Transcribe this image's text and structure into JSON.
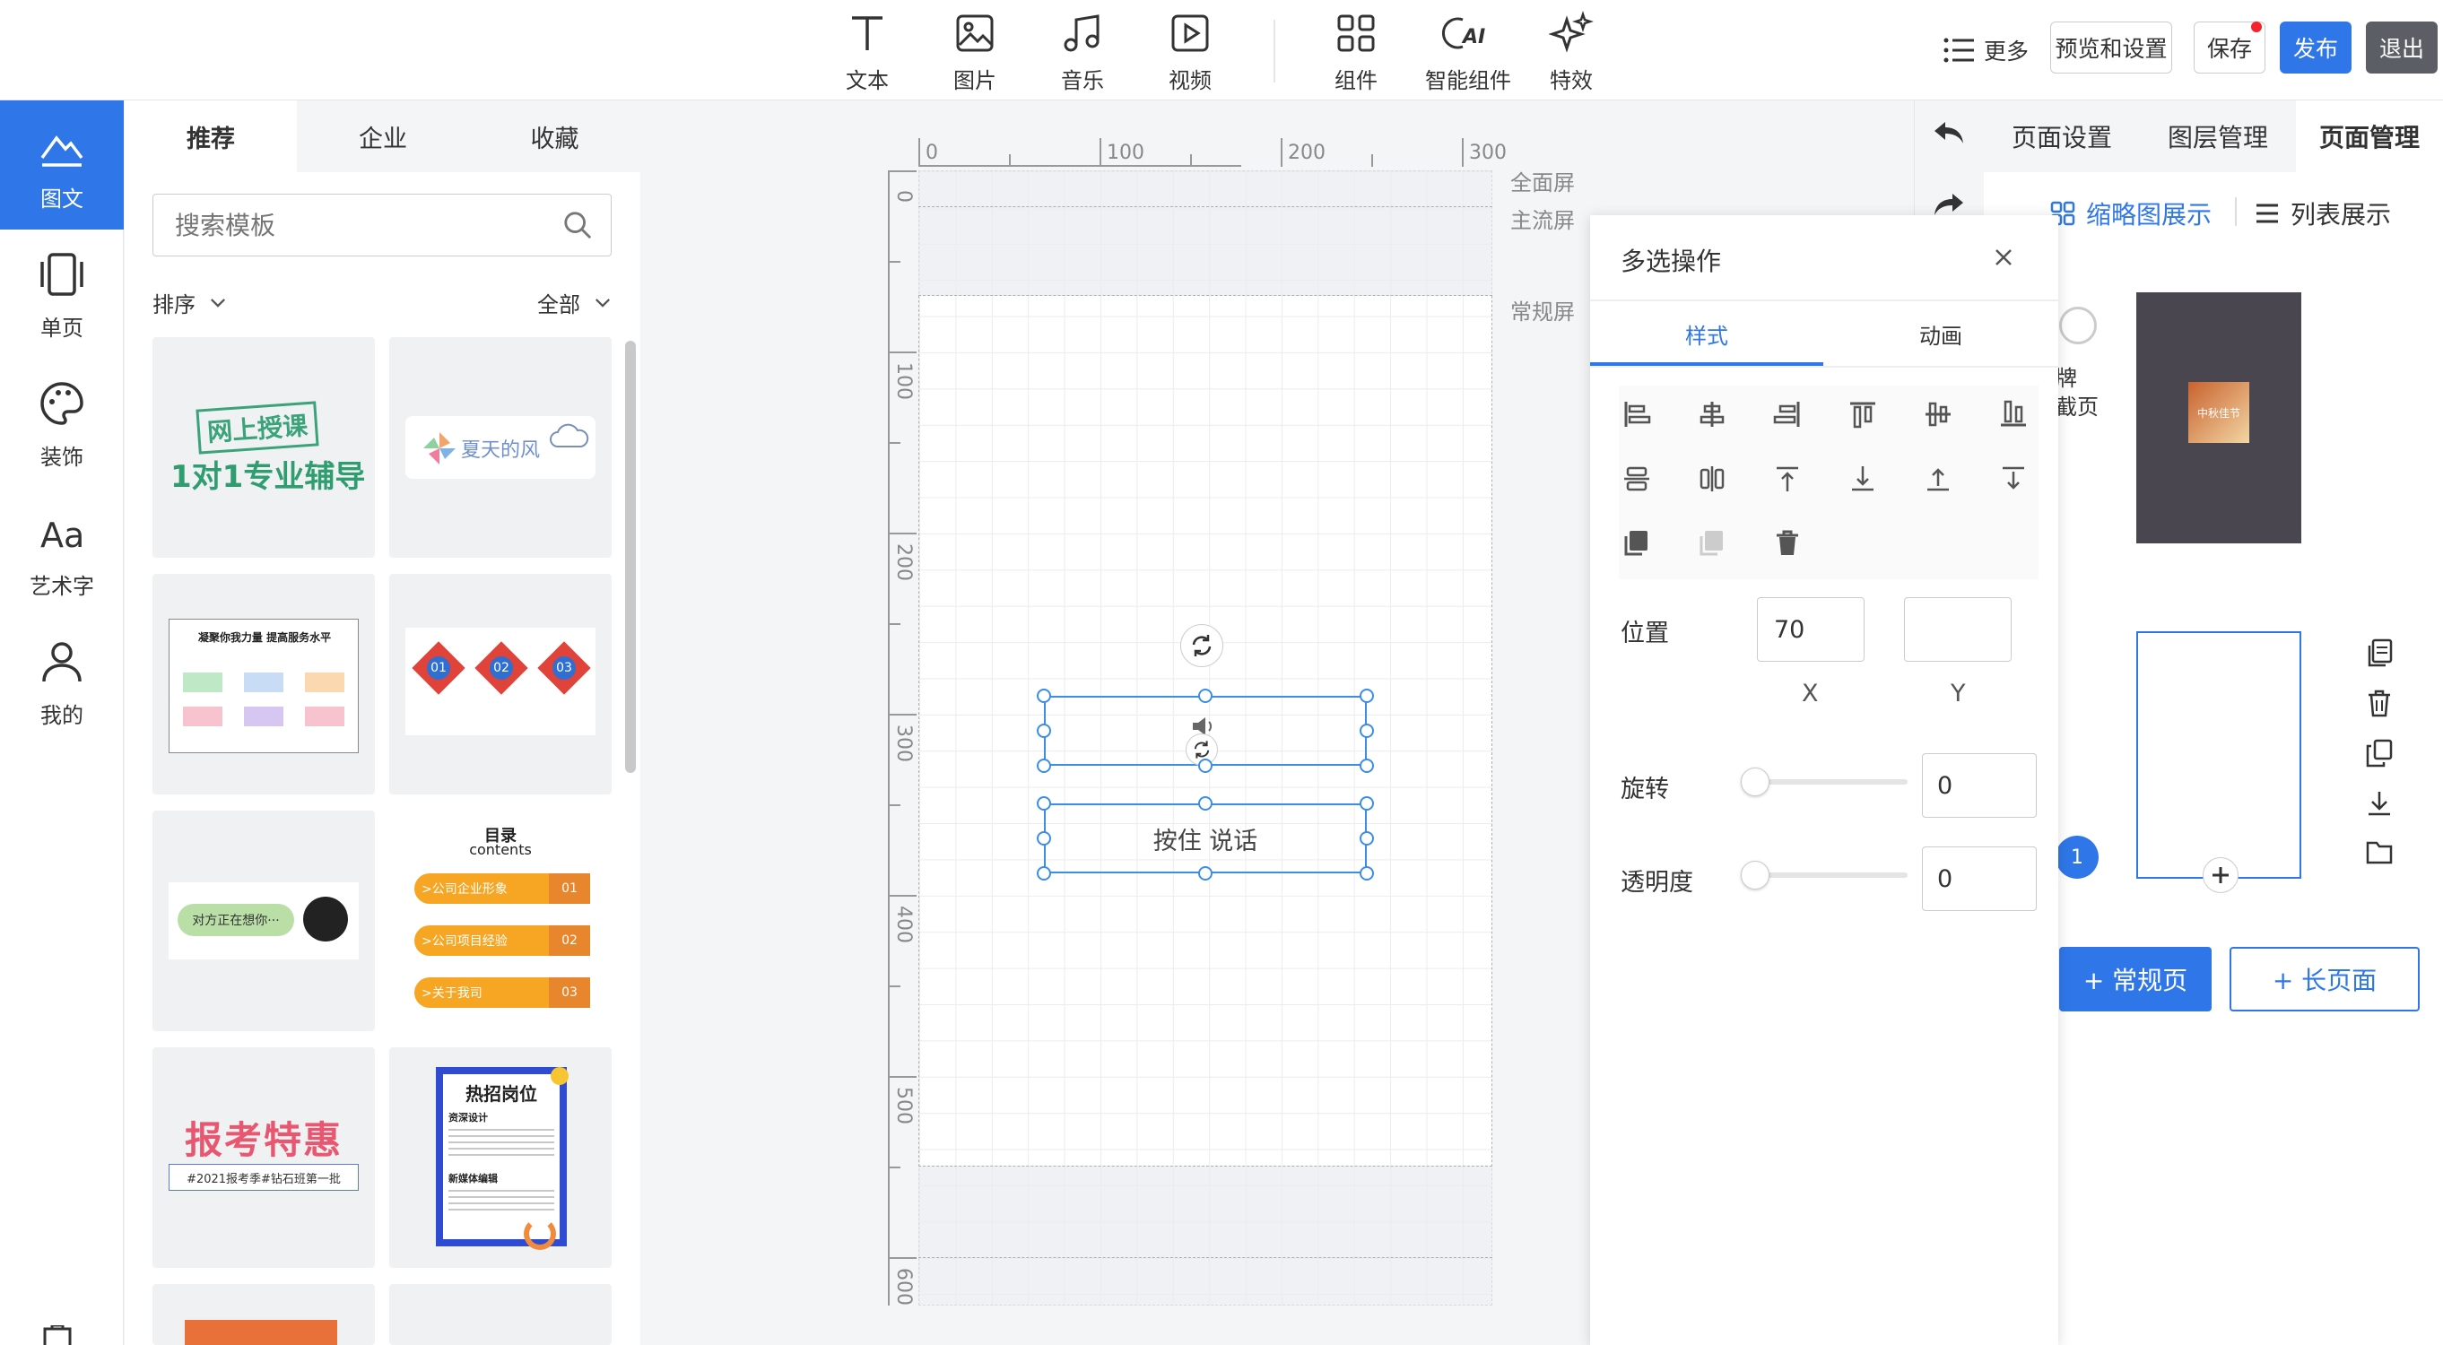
{
  "toolbar": {
    "text": "文本",
    "image": "图片",
    "music": "音乐",
    "video": "视频",
    "component": "组件",
    "smart_component": "智能组件",
    "effects": "特效",
    "more": "更多",
    "preview_settings": "预览和设置",
    "save": "保存",
    "publish": "发布",
    "exit": "退出",
    "accent": "#2f77e8"
  },
  "leftnav": [
    "图文",
    "单页",
    "装饰",
    "艺术字",
    "我的"
  ],
  "templates": {
    "tabs": [
      "推荐",
      "企业",
      "收藏"
    ],
    "search_placeholder": "搜索模板",
    "sort": "排序",
    "filter": "全部",
    "thumb1_a": "网上授课",
    "thumb1_b": "1对1专业辅导",
    "thumb2": "夏天的风",
    "thumb3": "凝聚你我力量 提高服务水平",
    "thumb4": [
      "01",
      "02",
      "03"
    ],
    "thumb5": "对方正在想你···",
    "thumb6_title": "目录",
    "thumb6_sub": "contents",
    "thumb6_items": [
      ">公司企业形象",
      ">公司项目经验",
      ">关于我司"
    ],
    "thumb6_nums": [
      "01",
      "02",
      "03"
    ],
    "thumb7_a": "报考特惠",
    "thumb7_b": "#2021报考季#钻石班第一批",
    "thumb8_title": "热招岗位",
    "thumb8_s1": "资深设计",
    "thumb8_s2": "新媒体编辑"
  },
  "canvas": {
    "ruler_top": [
      "0",
      "100",
      "200",
      "300"
    ],
    "ruler_left": [
      "0",
      "100",
      "200",
      "300",
      "400",
      "500",
      "600"
    ],
    "screen_labels": [
      "全面屏",
      "主流屏",
      "常规屏"
    ],
    "element_text": "按住 说话"
  },
  "multiselect": {
    "title": "多选操作",
    "tabs": [
      "样式",
      "动画"
    ],
    "position_label": "位置",
    "x_value": "70",
    "y_value": "",
    "x_label": "X",
    "y_label": "Y",
    "rotate_label": "旋转",
    "rotate_value": "0",
    "opacity_label": "透明度",
    "opacity_value": "0"
  },
  "right": {
    "tabs": [
      "页面设置",
      "图层管理",
      "页面管理"
    ],
    "thumb_view": "缩略图展示",
    "list_view": "列表展示",
    "partial_text_1": "牌",
    "partial_text_2": "截页",
    "page_number": "1",
    "add_regular": "+ 常规页",
    "add_long": "+ 长页面",
    "thumb_label": "中秋佳节"
  }
}
